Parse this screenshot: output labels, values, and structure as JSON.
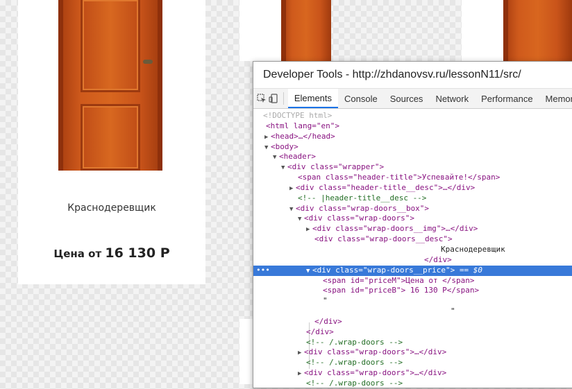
{
  "cards": [
    {
      "title": "Краснодеревщик",
      "price_prefix": "Цена от",
      "price_value": "16 130 Р"
    }
  ],
  "devtools": {
    "title": "Developer Tools - http://zhdanovsv.ru/lessonN11/src/",
    "tabs": [
      "Elements",
      "Console",
      "Sources",
      "Network",
      "Performance",
      "Memor"
    ],
    "active_tab": "Elements",
    "selected_suffix": "== $0",
    "tree": [
      "<!DOCTYPE html>",
      "<html lang=\"en\">",
      "<head>…</head>",
      "<body>",
      "<header>",
      "<div class=\"wrapper\">",
      "<span class=\"header-title\">Успевайте!</span>",
      "<div class=\"header-title__desc\">…</div>",
      "<!-- |header-title__desc -->",
      "<div class=\"wrap-doors__box\">",
      "<div class=\"wrap-doors\">",
      "<div class=\"wrap-doors__img\">…</div>",
      "<div class=\"wrap-doors__desc\">",
      "Краснодеревщик",
      "</div>",
      "<div class=\"wrap-doors__price\">",
      "<span id=\"priceM\">Цена от </span>",
      "<span id=\"priceB\"> 16 130 Р</span>",
      "\"",
      "\"",
      "</div>",
      "</div>",
      "<!-- /.wrap-doors -->",
      "<div class=\"wrap-doors\">…</div>",
      "<!-- /.wrap-doors -->",
      "<div class=\"wrap-doors\">…</div>",
      "<!-- /.wrap-doors -->"
    ]
  }
}
